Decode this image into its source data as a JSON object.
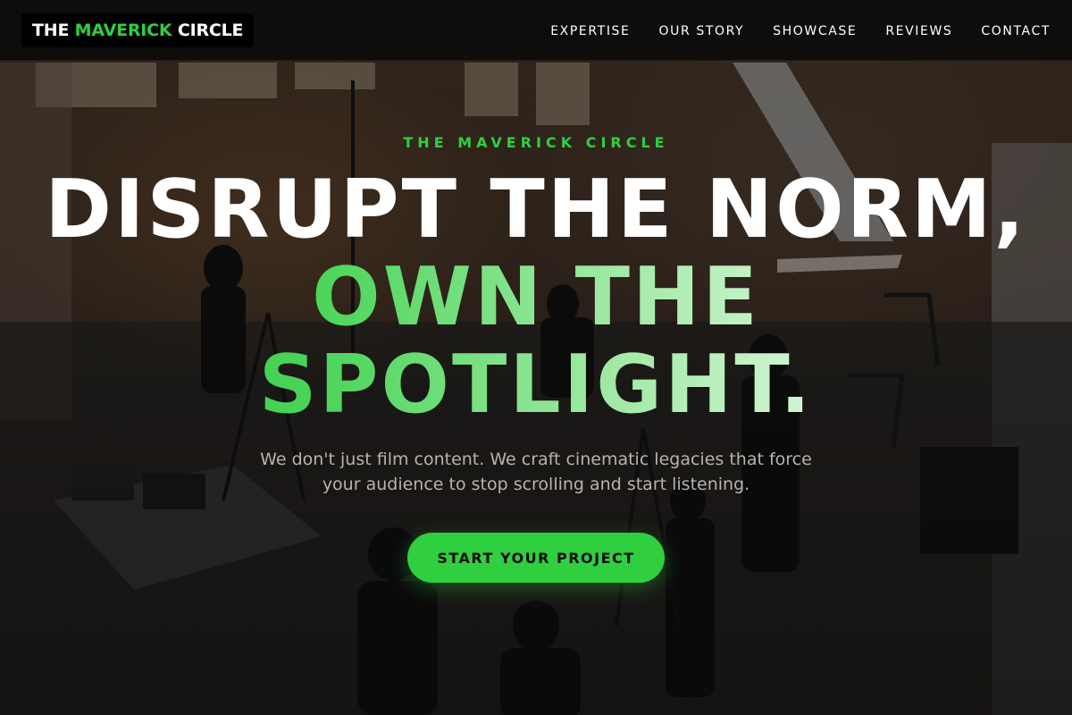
{
  "brand": {
    "name_part1": "THE ",
    "name_accent": "MAVERICK",
    "name_part2": " CIRCLE",
    "accent_color": "#2fcf3f"
  },
  "nav": {
    "items": [
      {
        "label": "EXPERTISE"
      },
      {
        "label": "OUR STORY"
      },
      {
        "label": "SHOWCASE"
      },
      {
        "label": "REVIEWS"
      },
      {
        "label": "CONTACT"
      }
    ]
  },
  "hero": {
    "eyebrow": "THE MAVERICK CIRCLE",
    "headline_line1": "DISRUPT THE NORM,",
    "headline_line2": "OWN THE",
    "headline_line3": "SPOTLIGHT.",
    "subtitle_line1": "We don't just film content. We craft cinematic legacies that force",
    "subtitle_line2": "your audience to stop scrolling and start listening.",
    "cta_label": "START YOUR PROJECT",
    "background_image": "film-production-warehouse-photo"
  }
}
